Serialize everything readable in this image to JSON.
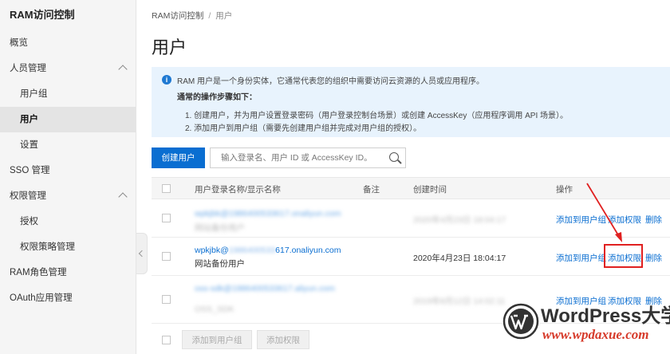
{
  "sidebar": {
    "title": "RAM访问控制",
    "items": [
      {
        "label": "概览"
      },
      {
        "label": "人员管理"
      },
      {
        "label": "用户组"
      },
      {
        "label": "用户"
      },
      {
        "label": "设置"
      },
      {
        "label": "SSO 管理"
      },
      {
        "label": "权限管理"
      },
      {
        "label": "授权"
      },
      {
        "label": "权限策略管理"
      },
      {
        "label": "RAM角色管理"
      },
      {
        "label": "OAuth应用管理"
      }
    ]
  },
  "breadcrumb": {
    "root": "RAM访问控制",
    "separator": "/",
    "current": "用户"
  },
  "page_title": "用户",
  "info": {
    "intro": "RAM 用户是一个身份实体，它通常代表您的组织中需要访问云资源的人员或应用程序。",
    "steps_title": "通常的操作步骤如下：",
    "step1": "1. 创建用户，并为用户设置登录密码（用户登录控制台场景）或创建 AccessKey（应用程序调用 API 场景）。",
    "step2": "2. 添加用户到用户组（需要先创建用户组并完成对用户组的授权）。"
  },
  "toolbar": {
    "create_label": "创建用户",
    "search_placeholder": "输入登录名、用户 ID 或 AccessKey ID。"
  },
  "table": {
    "headers": {
      "name": "用户登录名称/显示名称",
      "remark": "备注",
      "created": "创建时间",
      "actions": "操作"
    },
    "rows": [
      {
        "login": "wpkjbk@1986400533617.onaliyun.com",
        "display": "网站备份用户",
        "created": "2020年4月23日 18:04:17",
        "blurred": true
      },
      {
        "login_visible_start": "wpkjbk@",
        "login_hidden": "1986400533",
        "login_visible_end": "617.onaliyun.com",
        "display": "网站备份用户",
        "created": "2020年4月23日 18:04:17",
        "blurred": false
      },
      {
        "login": "oss-sdk@1986400533617.aliyun.com",
        "display": "OSS_SDK",
        "created": "2019年8月12日 14:02:11",
        "blurred": true
      }
    ],
    "actions": {
      "add_group": "添加到用户组",
      "add_permission": "添加权限",
      "delete": "删除"
    }
  },
  "bulk": {
    "add_group": "添加到用户组",
    "add_permission": "添加权限"
  },
  "watermark": {
    "brand": "WordPress大学",
    "url": "www.wpdaxue.com"
  },
  "colors": {
    "primary": "#0a6ed1",
    "info_bg": "#e8f3fd",
    "annotation": "#e02020",
    "watermark_red": "#d63a2a"
  }
}
